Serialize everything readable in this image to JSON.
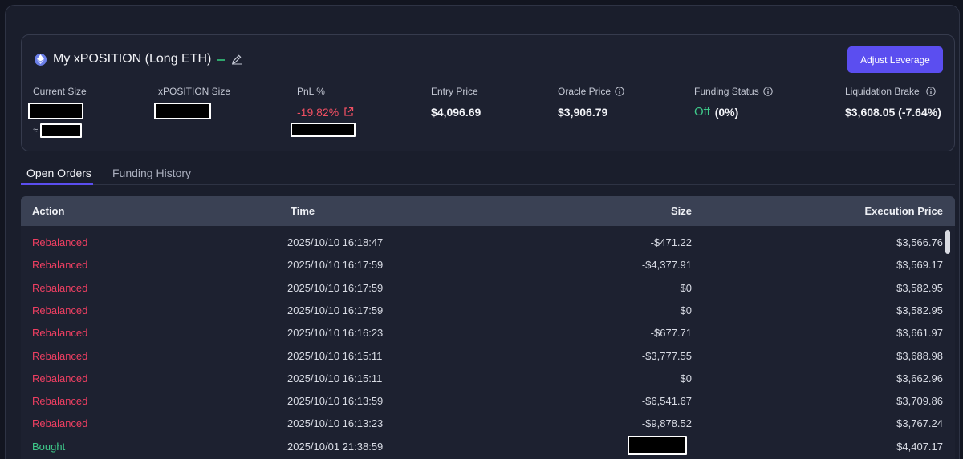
{
  "position": {
    "title": "My xPOSITION (Long ETH)",
    "adjust_button": "Adjust Leverage",
    "stats": {
      "current_size_label": "Current Size",
      "current_size_approx": "≈",
      "xposition_size_label": "xPOSITION Size",
      "pnl_label": "PnL %",
      "pnl_value": "-19.82%",
      "entry_price_label": "Entry Price",
      "entry_price_value": "$4,096.69",
      "oracle_price_label": "Oracle Price",
      "oracle_price_value": "$3,906.79",
      "funding_status_label": "Funding Status",
      "funding_status_state": "Off",
      "funding_status_rate": "(0%)",
      "liquidation_label": "Liquidation Brake",
      "liquidation_value": "$3,608.05 (-7.64%)"
    }
  },
  "tabs": {
    "open_orders": "Open Orders",
    "funding_history": "Funding History"
  },
  "table": {
    "headers": {
      "action": "Action",
      "time": "Time",
      "size": "Size",
      "execution_price": "Execution Price"
    },
    "rows": [
      {
        "action": "Rebalanced",
        "type": "red",
        "time": "2025/10/10 16:18:47",
        "size": "-$471.22",
        "price": "$3,566.76"
      },
      {
        "action": "Rebalanced",
        "type": "red",
        "time": "2025/10/10 16:17:59",
        "size": "-$4,377.91",
        "price": "$3,569.17"
      },
      {
        "action": "Rebalanced",
        "type": "red",
        "time": "2025/10/10 16:17:59",
        "size": "$0",
        "price": "$3,582.95"
      },
      {
        "action": "Rebalanced",
        "type": "red",
        "time": "2025/10/10 16:17:59",
        "size": "$0",
        "price": "$3,582.95"
      },
      {
        "action": "Rebalanced",
        "type": "red",
        "time": "2025/10/10 16:16:23",
        "size": "-$677.71",
        "price": "$3,661.97"
      },
      {
        "action": "Rebalanced",
        "type": "red",
        "time": "2025/10/10 16:15:11",
        "size": "-$3,777.55",
        "price": "$3,688.98"
      },
      {
        "action": "Rebalanced",
        "type": "red",
        "time": "2025/10/10 16:15:11",
        "size": "$0",
        "price": "$3,662.96"
      },
      {
        "action": "Rebalanced",
        "type": "red",
        "time": "2025/10/10 16:13:59",
        "size": "-$6,541.67",
        "price": "$3,709.86"
      },
      {
        "action": "Rebalanced",
        "type": "red",
        "time": "2025/10/10 16:13:23",
        "size": "-$9,878.52",
        "price": "$3,767.24"
      },
      {
        "action": "Bought",
        "type": "green",
        "time": "2025/10/01 21:38:59",
        "size": "",
        "price": "$4,407.17"
      }
    ]
  },
  "colors": {
    "accent": "#5b4ef0",
    "negative": "#ef4f62",
    "positive": "#3ec98a"
  }
}
